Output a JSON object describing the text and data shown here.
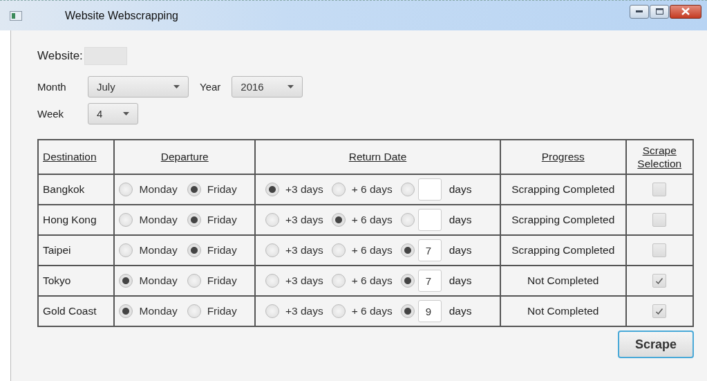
{
  "window": {
    "title": "Website Webscrapping"
  },
  "website": {
    "label": "Website:"
  },
  "filters": [
    {
      "label": "Month",
      "value": "July"
    },
    {
      "label": "Year",
      "value": "2016"
    },
    {
      "label": "Week",
      "value": "4"
    }
  ],
  "table": {
    "columns": [
      "Destination",
      "Departure",
      "Return Date",
      "Progress",
      "Scrape Selection"
    ],
    "rows": [
      {
        "destination": "Bangkok",
        "departure": [
          {
            "label": "Monday",
            "selected": false
          },
          {
            "label": "Friday",
            "selected": true
          }
        ],
        "return": [
          {
            "kind": "preset",
            "label": "+3 days",
            "selected": true
          },
          {
            "kind": "preset",
            "label": "+ 6 days",
            "selected": false
          },
          {
            "kind": "custom",
            "selected": false,
            "unit": "days"
          }
        ],
        "progress": "Scrapping Completed",
        "checked": false
      },
      {
        "destination": "Hong Kong",
        "departure": [
          {
            "label": "Monday",
            "selected": false
          },
          {
            "label": "Friday",
            "selected": true
          }
        ],
        "return": [
          {
            "kind": "preset",
            "label": "+3 days",
            "selected": false
          },
          {
            "kind": "preset",
            "label": "+ 6 days",
            "selected": true
          },
          {
            "kind": "custom",
            "selected": false,
            "unit": "days"
          }
        ],
        "progress": "Scrapping Completed",
        "checked": false
      },
      {
        "destination": "Taipei",
        "departure": [
          {
            "label": "Monday",
            "selected": false
          },
          {
            "label": "Friday",
            "selected": true
          }
        ],
        "return": [
          {
            "kind": "preset",
            "label": "+3 days",
            "selected": false
          },
          {
            "kind": "preset",
            "label": "+ 6 days",
            "selected": false
          },
          {
            "kind": "custom",
            "selected": true,
            "value": "7",
            "unit": "days"
          }
        ],
        "progress": "Scrapping Completed",
        "checked": false
      },
      {
        "destination": "Tokyo",
        "departure": [
          {
            "label": "Monday",
            "selected": true
          },
          {
            "label": "Friday",
            "selected": false
          }
        ],
        "return": [
          {
            "kind": "preset",
            "label": "+3 days",
            "selected": false
          },
          {
            "kind": "preset",
            "label": "+ 6 days",
            "selected": false
          },
          {
            "kind": "custom",
            "selected": true,
            "value": "7",
            "unit": "days"
          }
        ],
        "progress": "Not Completed",
        "checked": true
      },
      {
        "destination": "Gold Coast",
        "departure": [
          {
            "label": "Monday",
            "selected": true
          },
          {
            "label": "Friday",
            "selected": false
          }
        ],
        "return": [
          {
            "kind": "preset",
            "label": "+3 days",
            "selected": false
          },
          {
            "kind": "preset",
            "label": "+ 6 days",
            "selected": false
          },
          {
            "kind": "custom",
            "selected": true,
            "value": "9",
            "unit": "days"
          }
        ],
        "progress": "Not Completed",
        "checked": true
      }
    ]
  },
  "buttons": [
    {
      "label": "Scrape"
    }
  ]
}
